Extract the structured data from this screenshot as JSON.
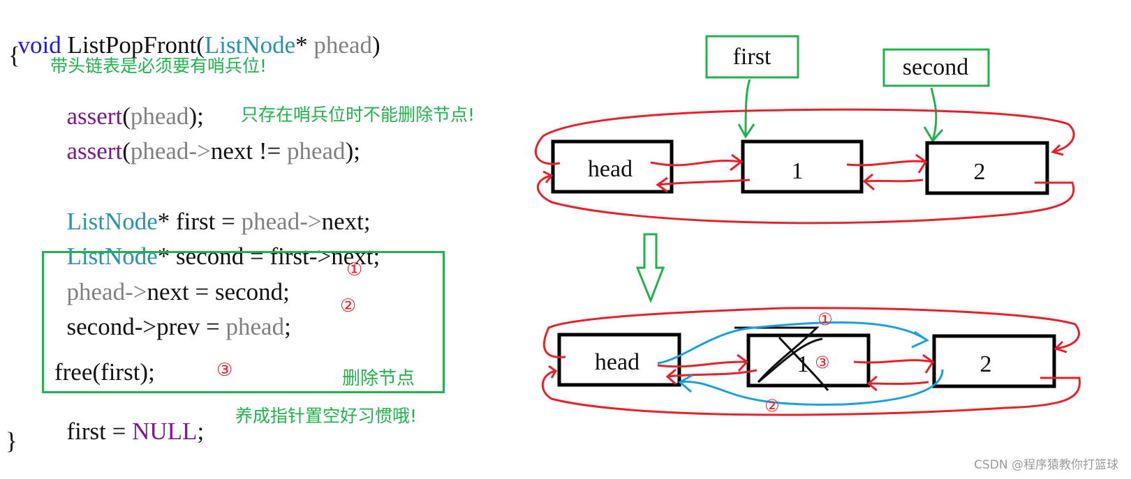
{
  "code": {
    "line1": {
      "kw": "void",
      "name": " ListPopFront(",
      "type": "ListNode",
      "star": "* ",
      "param": "phead",
      "close": ")"
    },
    "open_brace": "{",
    "line_assert1": {
      "fn": "assert",
      "open": "(",
      "arg": "phead",
      "close": ");"
    },
    "line_assert2": {
      "fn": "assert",
      "open": "(",
      "arg": "phead->",
      "mid": "next != ",
      "arg2": "phead",
      "close": ");"
    },
    "line_first": {
      "type": "ListNode",
      "rest1": "* first = ",
      "arg": "phead->",
      "rest2": "next;"
    },
    "line_second": {
      "type": "ListNode",
      "rest1": "* second = first->next;"
    },
    "line_step1": {
      "arg": "phead->",
      "rest": "next = second;"
    },
    "line_step2": {
      "rest1": "second->prev = ",
      "arg": "phead",
      "rest2": ";"
    },
    "line_free": "free(first);",
    "line_null": {
      "rest1": "first = ",
      "macro": "NULL",
      "rest2": ";"
    },
    "close_brace": "}"
  },
  "annotations": {
    "sentinel_required": "带头链表是必须要有哨兵位!",
    "cannot_delete": "只存在哨兵位时不能删除节点!",
    "delete_node": "删除节点",
    "set_null_habit": "养成指针置空好习惯哦!"
  },
  "step_markers": [
    "①",
    "②",
    "③"
  ],
  "diagram": {
    "top": {
      "pointers": [
        "first",
        "second"
      ],
      "nodes": [
        "head",
        "1",
        "2"
      ]
    },
    "bottom": {
      "nodes": [
        "head",
        "1",
        "2"
      ],
      "markers": [
        "①",
        "②",
        "③"
      ]
    }
  },
  "colors": {
    "link": "#e8202a",
    "new_link": "#1aa0e0",
    "pointer": "#22b14c",
    "node_border": "#000000"
  },
  "watermark": "CSDN @程序猿教你打篮球"
}
